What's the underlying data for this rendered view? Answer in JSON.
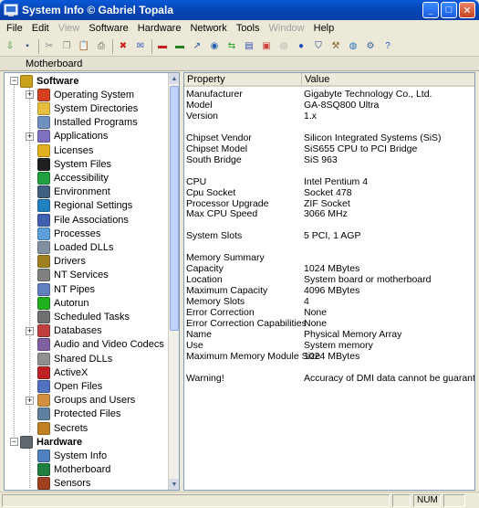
{
  "window": {
    "title": "System Info  © Gabriel Topala",
    "min": "_",
    "max": "□",
    "close": "✕"
  },
  "menu": [
    {
      "label": "File",
      "enabled": true
    },
    {
      "label": "Edit",
      "enabled": true
    },
    {
      "label": "View",
      "enabled": false
    },
    {
      "label": "Software",
      "enabled": true
    },
    {
      "label": "Hardware",
      "enabled": true
    },
    {
      "label": "Network",
      "enabled": true
    },
    {
      "label": "Tools",
      "enabled": true
    },
    {
      "label": "Window",
      "enabled": false
    },
    {
      "label": "Help",
      "enabled": true
    }
  ],
  "toolbar": [
    {
      "name": "export-icon",
      "color": "#2a8a2a",
      "glyph": "⇩"
    },
    {
      "name": "save-icon",
      "color": "#4b5a8a",
      "glyph": "▪"
    },
    {
      "name": "cut-icon",
      "color": "#888888",
      "glyph": "✂"
    },
    {
      "name": "copy-icon",
      "color": "#888888",
      "glyph": "❐"
    },
    {
      "name": "paste-icon",
      "color": "#888888",
      "glyph": "📋"
    },
    {
      "name": "print-icon",
      "color": "#555555",
      "glyph": "⎙"
    },
    {
      "name": "stop-icon",
      "color": "#d02020",
      "glyph": "✖"
    },
    {
      "name": "message-icon",
      "color": "#4060c0",
      "glyph": "✉"
    },
    {
      "name": "display-icon",
      "color": "#c02020",
      "glyph": "▬"
    },
    {
      "name": "monitor-icon",
      "color": "#208020",
      "glyph": "▬"
    },
    {
      "name": "chart-icon",
      "color": "#2050a0",
      "glyph": "↗"
    },
    {
      "name": "globe-icon",
      "color": "#2060b0",
      "glyph": "◉"
    },
    {
      "name": "transfer-icon",
      "color": "#20a020",
      "glyph": "⇆"
    },
    {
      "name": "document-icon",
      "color": "#3050b0",
      "glyph": "▤"
    },
    {
      "name": "wallpaper-icon",
      "color": "#d04040",
      "glyph": "▣"
    },
    {
      "name": "cd-icon",
      "color": "#a0a0a0",
      "glyph": "◎"
    },
    {
      "name": "network-icon",
      "color": "#2050c0",
      "glyph": "●"
    },
    {
      "name": "shield-icon",
      "color": "#1a3a8a",
      "glyph": "⛉"
    },
    {
      "name": "tools-icon",
      "color": "#806020",
      "glyph": "⚒"
    },
    {
      "name": "web-icon",
      "color": "#2070c0",
      "glyph": "◍"
    },
    {
      "name": "settings-icon",
      "color": "#3060a0",
      "glyph": "⚙"
    },
    {
      "name": "help-icon",
      "color": "#2050d0",
      "glyph": "?"
    }
  ],
  "header": {
    "title": "Motherboard"
  },
  "tree": [
    {
      "label": "Software",
      "level": 0,
      "category": true,
      "expander": "−",
      "icon": "software-icon",
      "color": "#c9a11d"
    },
    {
      "label": "Operating System",
      "level": 1,
      "expander": "+",
      "icon": "windows-icon",
      "color": "#d04020"
    },
    {
      "label": "System Directories",
      "level": 1,
      "icon": "folder-icon",
      "color": "#e8c040"
    },
    {
      "label": "Installed Programs",
      "level": 1,
      "icon": "programs-icon",
      "color": "#7090c0"
    },
    {
      "label": "Applications",
      "level": 1,
      "expander": "+",
      "icon": "applications-icon",
      "color": "#8070c0"
    },
    {
      "label": "Licenses",
      "level": 1,
      "icon": "key-icon",
      "color": "#e0b020"
    },
    {
      "label": "System Files",
      "level": 1,
      "icon": "console-icon",
      "color": "#202020"
    },
    {
      "label": "Accessibility",
      "level": 1,
      "icon": "accessibility-icon",
      "color": "#20a040"
    },
    {
      "label": "Environment",
      "level": 1,
      "icon": "environment-icon",
      "color": "#406080"
    },
    {
      "label": "Regional Settings",
      "level": 1,
      "icon": "regional-icon",
      "color": "#2080c0"
    },
    {
      "label": "File Associations",
      "level": 1,
      "icon": "associations-icon",
      "color": "#4060b0"
    },
    {
      "label": "Processes",
      "level": 1,
      "icon": "processes-icon",
      "color": "#60a0e0"
    },
    {
      "label": "Loaded DLLs",
      "level": 1,
      "icon": "dll-icon",
      "color": "#8090a0"
    },
    {
      "label": "Drivers",
      "level": 1,
      "icon": "drivers-icon",
      "color": "#a08020"
    },
    {
      "label": "NT Services",
      "level": 1,
      "icon": "services-icon",
      "color": "#808080"
    },
    {
      "label": "NT Pipes",
      "level": 1,
      "icon": "pipes-icon",
      "color": "#6080c0"
    },
    {
      "label": "Autorun",
      "level": 1,
      "icon": "autorun-icon",
      "color": "#20b020"
    },
    {
      "label": "Scheduled Tasks",
      "level": 1,
      "icon": "tasks-icon",
      "color": "#707070"
    },
    {
      "label": "Databases",
      "level": 1,
      "expander": "+",
      "icon": "database-icon",
      "color": "#c04040"
    },
    {
      "label": "Audio and Video Codecs",
      "level": 1,
      "icon": "codecs-icon",
      "color": "#8060a0"
    },
    {
      "label": "Shared DLLs",
      "level": 1,
      "icon": "shared-dll-icon",
      "color": "#909090"
    },
    {
      "label": "ActiveX",
      "level": 1,
      "icon": "activex-icon",
      "color": "#c02020"
    },
    {
      "label": "Open Files",
      "level": 1,
      "icon": "open-files-icon",
      "color": "#5070c0"
    },
    {
      "label": "Groups and Users",
      "level": 1,
      "expander": "+",
      "icon": "users-icon",
      "color": "#d09040"
    },
    {
      "label": "Protected Files",
      "level": 1,
      "icon": "protected-files-icon",
      "color": "#6080a0"
    },
    {
      "label": "Secrets",
      "level": 1,
      "icon": "secrets-icon",
      "color": "#c08020"
    },
    {
      "label": "Hardware",
      "level": 0,
      "category": true,
      "expander": "−",
      "icon": "hardware-icon",
      "color": "#606870"
    },
    {
      "label": "System Info",
      "level": 1,
      "icon": "computer-icon",
      "color": "#5080c0"
    },
    {
      "label": "Motherboard",
      "level": 1,
      "icon": "motherboard-icon",
      "color": "#208040"
    },
    {
      "label": "Sensors",
      "level": 1,
      "icon": "sensors-icon",
      "color": "#a04020"
    }
  ],
  "columns": {
    "property": "Property",
    "value": "Value"
  },
  "rows": [
    {
      "p": "Manufacturer",
      "v": "Gigabyte Technology Co., Ltd."
    },
    {
      "p": "Model",
      "v": "GA-8SQ800 Ultra"
    },
    {
      "p": "Version",
      "v": "1.x"
    },
    {
      "p": "",
      "v": ""
    },
    {
      "p": "Chipset Vendor",
      "v": "Silicon Integrated Systems (SiS)"
    },
    {
      "p": "Chipset Model",
      "v": "SiS655 CPU to PCI Bridge"
    },
    {
      "p": "South Bridge",
      "v": "SiS 963"
    },
    {
      "p": "",
      "v": ""
    },
    {
      "p": "CPU",
      "v": "Intel Pentium 4"
    },
    {
      "p": "Cpu Socket",
      "v": "Socket 478"
    },
    {
      "p": "Processor Upgrade",
      "v": "ZIF Socket"
    },
    {
      "p": "Max CPU Speed",
      "v": "3066 MHz"
    },
    {
      "p": "",
      "v": ""
    },
    {
      "p": "System Slots",
      "v": "5 PCI, 1 AGP"
    },
    {
      "p": "",
      "v": ""
    },
    {
      "p": "Memory Summary",
      "v": ""
    },
    {
      "p": "Capacity",
      "v": "1024 MBytes"
    },
    {
      "p": "Location",
      "v": "System board or motherboard"
    },
    {
      "p": "Maximum Capacity",
      "v": "4096 MBytes"
    },
    {
      "p": "Memory Slots",
      "v": "4"
    },
    {
      "p": "Error Correction",
      "v": "None"
    },
    {
      "p": "Error Correction Capabilities",
      "v": "None"
    },
    {
      "p": "Name",
      "v": "Physical Memory Array"
    },
    {
      "p": "Use",
      "v": "System memory"
    },
    {
      "p": "Maximum Memory Module Size",
      "v": "1024 MBytes"
    },
    {
      "p": "",
      "v": ""
    },
    {
      "p": "Warning!",
      "v": "Accuracy of DMI data cannot be guaranteed"
    }
  ],
  "status": {
    "num": "NUM"
  }
}
